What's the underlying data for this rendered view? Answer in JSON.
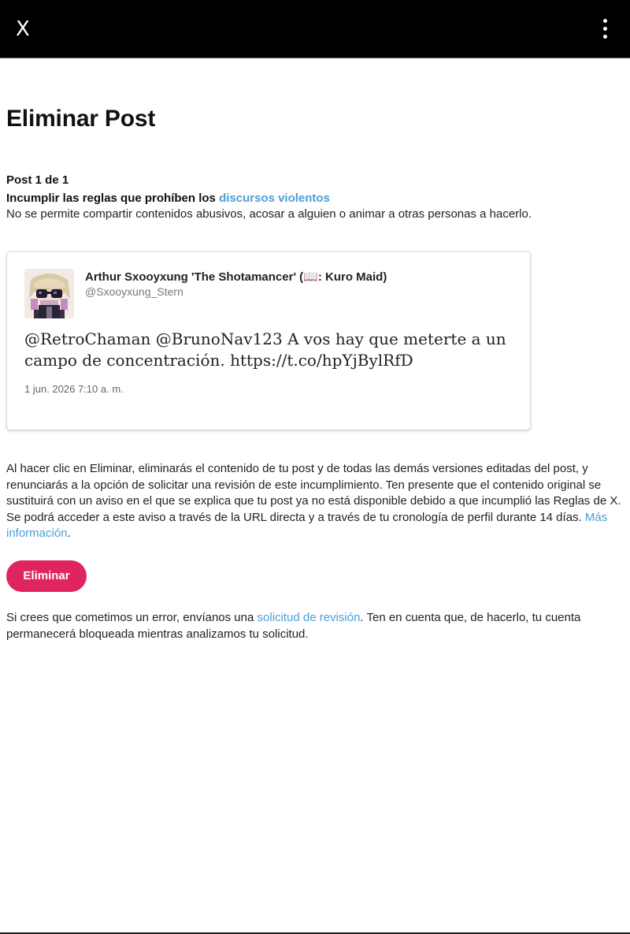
{
  "topbar": {
    "close_label": "X"
  },
  "page": {
    "title": "Eliminar Post",
    "post_count": "Post 1 de 1",
    "rule_prefix": "Incumplir las reglas que prohíben los ",
    "rule_link": "discursos violentos",
    "rule_description": "No se permite compartir contenidos abusivos, acosar a alguien o animar a otras personas a hacerlo."
  },
  "post": {
    "author_name": "Arthur Sxooyxung 'The Shotamancer' (📖: Kuro Maid)",
    "author_handle": "@Sxooyxung_Stern",
    "text": "@RetroChaman @BrunoNav123 A vos hay que meterte a un campo de concentración. https://t.co/hpYjBylRfD",
    "date": "1 jun. 2026 7:10 a. m."
  },
  "explanation": {
    "text": "Al hacer clic en Eliminar, eliminarás el contenido de tu post y de todas las demás versiones editadas del post, y renunciarás a la opción de solicitar una revisión de este incumplimiento. Ten presente que el contenido original se sustituirá con un aviso en el que se explica que tu post ya no está disponible debido a que incumplió las Reglas de X. Se podrá acceder a este aviso a través de la URL directa y a través de tu cronología de perfil durante 14 días. ",
    "link": "Más información",
    "suffix": "."
  },
  "delete_button": {
    "label": "Eliminar"
  },
  "review": {
    "prefix": "Si crees que cometimos un error, envíanos una ",
    "link": "solicitud de revisión",
    "suffix": ". Ten en cuenta que, de hacerlo, tu cuenta permanecerá bloqueada mientras analizamos tu solicitud."
  },
  "colors": {
    "topbar_bg": "#000000",
    "link": "#4a9fd5",
    "delete_button": "#e0245e"
  },
  "icons": {
    "close": "close-icon",
    "menu": "more-vertical-icon"
  }
}
